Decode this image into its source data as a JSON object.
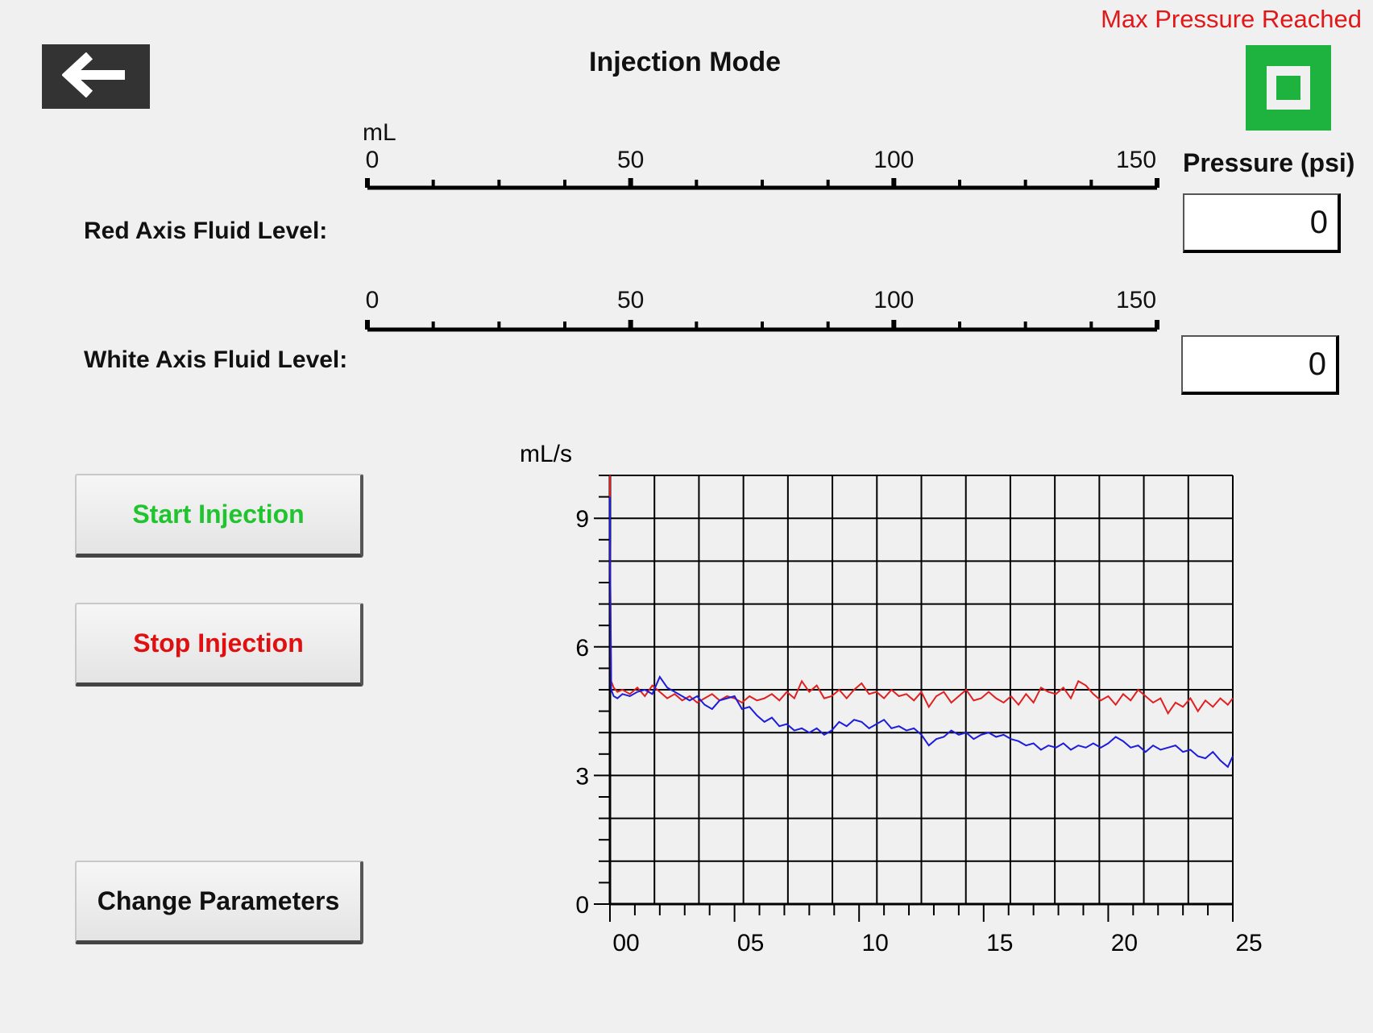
{
  "header": {
    "title": "Injection Mode",
    "status_text": "Max Pressure Reached",
    "back_icon": "arrow-left-icon",
    "status_color": "#1db33e"
  },
  "pressure": {
    "label": "Pressure (psi)",
    "red_value": "0",
    "white_value": "0"
  },
  "fluid_scales": {
    "unit": "mL",
    "ticks": [
      "0",
      "50",
      "100",
      "150"
    ],
    "range": [
      0,
      150
    ],
    "red_label": "Red Axis Fluid Level:",
    "white_label": "White Axis Fluid Level:"
  },
  "buttons": {
    "start": "Start Injection",
    "stop": "Stop Injection",
    "change": "Change Parameters",
    "start_color": "#1fc42e",
    "stop_color": "#e01010"
  },
  "chart_data": {
    "type": "line",
    "ylabel": "mL/s",
    "ylim": [
      0,
      10
    ],
    "xlim": [
      0,
      25
    ],
    "yticks": [
      "0",
      "3",
      "6",
      "9"
    ],
    "xticks": [
      "00",
      "05",
      "10",
      "15",
      "20",
      "25"
    ],
    "grid": true,
    "series": [
      {
        "color": "#e02020",
        "x": [
          0,
          0,
          0.05,
          0.15,
          0.3,
          0.5,
          0.8,
          1.1,
          1.4,
          1.7,
          2.0,
          2.3,
          2.6,
          2.9,
          3.2,
          3.5,
          3.8,
          4.1,
          4.4,
          4.7,
          5.0,
          5.3,
          5.6,
          5.9,
          6.2,
          6.5,
          6.8,
          7.1,
          7.4,
          7.7,
          8.0,
          8.3,
          8.6,
          8.9,
          9.2,
          9.5,
          9.8,
          10.1,
          10.4,
          10.7,
          11.0,
          11.3,
          11.6,
          11.9,
          12.2,
          12.5,
          12.8,
          13.1,
          13.4,
          13.7,
          14.0,
          14.3,
          14.6,
          14.9,
          15.2,
          15.5,
          15.8,
          16.1,
          16.4,
          16.7,
          17.0,
          17.3,
          17.6,
          17.9,
          18.2,
          18.5,
          18.8,
          19.1,
          19.4,
          19.7,
          20.0,
          20.3,
          20.6,
          20.9,
          21.2,
          21.5,
          21.8,
          22.1,
          22.4,
          22.7,
          23.0,
          23.3,
          23.6,
          23.9,
          24.2,
          24.5,
          24.8,
          25.0
        ],
        "y": [
          10,
          8.5,
          5.2,
          5.05,
          4.95,
          5.0,
          4.9,
          5.05,
          4.85,
          5.1,
          4.95,
          4.8,
          4.9,
          4.75,
          4.85,
          4.7,
          4.8,
          4.9,
          4.75,
          4.85,
          4.8,
          4.7,
          4.85,
          4.75,
          4.8,
          4.9,
          4.75,
          4.95,
          4.8,
          5.2,
          4.95,
          5.1,
          4.8,
          4.85,
          5.0,
          4.8,
          5.0,
          5.15,
          4.9,
          4.95,
          4.8,
          5.0,
          4.85,
          4.9,
          4.75,
          4.95,
          4.6,
          4.85,
          4.95,
          4.7,
          4.85,
          5.0,
          4.75,
          4.8,
          4.95,
          4.8,
          4.7,
          4.85,
          4.65,
          4.9,
          4.7,
          5.05,
          4.95,
          4.9,
          5.05,
          4.8,
          5.2,
          5.1,
          4.9,
          4.75,
          4.85,
          4.65,
          4.9,
          4.75,
          5.0,
          4.85,
          4.7,
          4.8,
          4.45,
          4.7,
          4.6,
          4.8,
          4.5,
          4.75,
          4.6,
          4.8,
          4.65,
          4.8
        ]
      },
      {
        "color": "#1c1cdc",
        "x": [
          0,
          0,
          0.05,
          0.15,
          0.3,
          0.5,
          0.8,
          1.1,
          1.4,
          1.7,
          2.0,
          2.3,
          2.6,
          2.9,
          3.2,
          3.5,
          3.8,
          4.1,
          4.4,
          4.7,
          5.0,
          5.3,
          5.6,
          5.9,
          6.2,
          6.5,
          6.8,
          7.1,
          7.4,
          7.7,
          8.0,
          8.3,
          8.6,
          8.9,
          9.2,
          9.5,
          9.8,
          10.1,
          10.4,
          10.7,
          11.0,
          11.3,
          11.6,
          11.9,
          12.2,
          12.5,
          12.8,
          13.1,
          13.4,
          13.7,
          14.0,
          14.3,
          14.6,
          14.9,
          15.2,
          15.5,
          15.8,
          16.1,
          16.4,
          16.7,
          17.0,
          17.3,
          17.6,
          17.9,
          18.2,
          18.5,
          18.8,
          19.1,
          19.4,
          19.7,
          20.0,
          20.3,
          20.6,
          20.9,
          21.2,
          21.5,
          21.8,
          22.1,
          22.4,
          22.7,
          23.0,
          23.3,
          23.6,
          23.9,
          24.2,
          24.5,
          24.8,
          25.0
        ],
        "y": [
          9.5,
          8.6,
          5.0,
          4.85,
          4.8,
          4.9,
          4.85,
          4.95,
          5.0,
          4.9,
          5.3,
          5.05,
          4.95,
          4.85,
          4.75,
          4.85,
          4.65,
          4.55,
          4.75,
          4.8,
          4.85,
          4.55,
          4.6,
          4.4,
          4.25,
          4.35,
          4.15,
          4.2,
          4.05,
          4.1,
          4.0,
          4.1,
          3.95,
          4.05,
          4.25,
          4.15,
          4.3,
          4.25,
          4.1,
          4.2,
          4.3,
          4.1,
          4.15,
          4.05,
          4.1,
          3.95,
          3.7,
          3.85,
          3.9,
          4.05,
          3.95,
          4.0,
          3.85,
          3.95,
          4.0,
          3.9,
          3.95,
          3.85,
          3.8,
          3.7,
          3.75,
          3.6,
          3.7,
          3.65,
          3.75,
          3.6,
          3.7,
          3.65,
          3.75,
          3.65,
          3.75,
          3.9,
          3.8,
          3.65,
          3.7,
          3.55,
          3.7,
          3.6,
          3.65,
          3.7,
          3.55,
          3.6,
          3.45,
          3.4,
          3.55,
          3.35,
          3.2,
          3.45
        ]
      }
    ]
  }
}
